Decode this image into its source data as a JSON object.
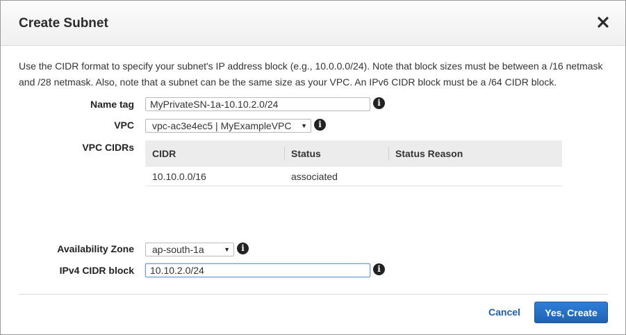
{
  "dialog": {
    "title": "Create Subnet",
    "description": "Use the CIDR format to specify your subnet's IP address block (e.g., 10.0.0.0/24). Note that block sizes must be between a /16 netmask and /28 netmask. Also, note that a subnet can be the same size as your VPC. An IPv6 CIDR block must be a /64 CIDR block."
  },
  "form": {
    "name_tag": {
      "label": "Name tag",
      "value": "MyPrivateSN-1a-10.10.2.0/24"
    },
    "vpc": {
      "label": "VPC",
      "selected": "vpc-ac3e4ec5 | MyExampleVPC"
    },
    "vpc_cidrs": {
      "label": "VPC CIDRs",
      "columns": [
        "CIDR",
        "Status",
        "Status Reason"
      ],
      "rows": [
        {
          "cidr": "10.10.0.0/16",
          "status": "associated",
          "reason": ""
        }
      ]
    },
    "availability_zone": {
      "label": "Availability Zone",
      "selected": "ap-south-1a"
    },
    "ipv4_cidr": {
      "label": "IPv4 CIDR block",
      "value": "10.10.2.0/24"
    }
  },
  "footer": {
    "cancel_label": "Cancel",
    "create_label": "Yes, Create"
  },
  "icons": {
    "info_glyph": "i",
    "dropdown_glyph": "▼"
  },
  "colors": {
    "primary": "#1e63b3",
    "link": "#1f5fa8",
    "status_ok": "#1d8102"
  }
}
